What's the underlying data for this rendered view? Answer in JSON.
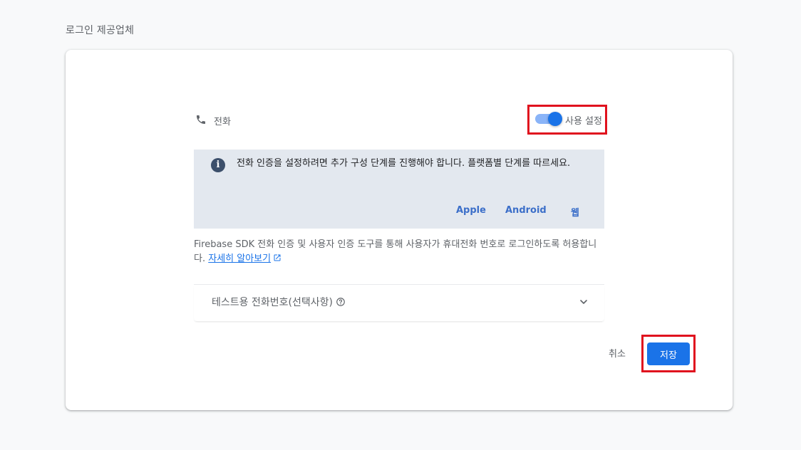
{
  "section_title": "로그인 제공업체",
  "provider": {
    "label": "전화",
    "icon": "phone-icon",
    "toggle_label": "사용 설정",
    "enabled": true
  },
  "info": {
    "text": "전화 인증을 설정하려면 추가 구성 단계를 진행해야 합니다. 플랫폼별 단계를 따르세요.",
    "platforms": [
      "Apple",
      "Android",
      "웹"
    ]
  },
  "description": {
    "text": "Firebase SDK 전화 인증 및 사용자 인증 도구를 통해 사용자가 휴대전화 번호로 로그인하도록 허용합니다. ",
    "learn_more": "자세히 알아보기"
  },
  "expander": {
    "label": "테스트용 전화번호(선택사항)"
  },
  "buttons": {
    "cancel": "취소",
    "save": "저장"
  },
  "colors": {
    "accent": "#1a73e8",
    "highlight": "#e0121e",
    "info_bg": "#e3e8ef"
  }
}
